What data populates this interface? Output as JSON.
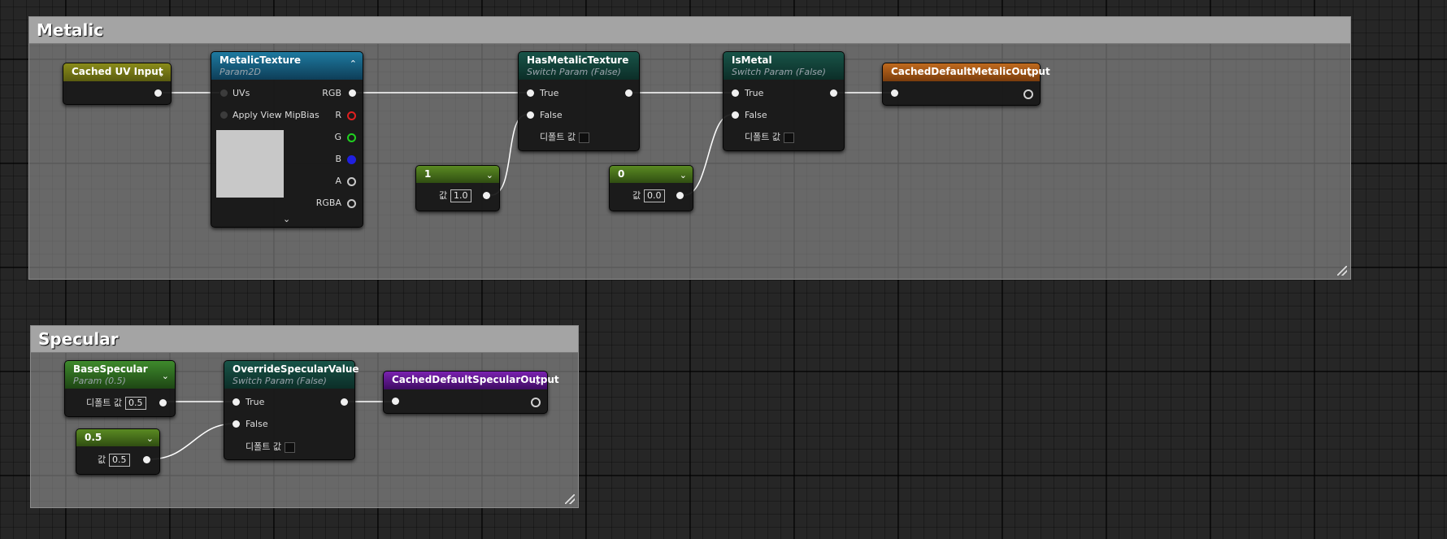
{
  "metalic_group": {
    "title": "Metalic"
  },
  "specular_group": {
    "title": "Specular"
  },
  "nodes": {
    "cached_uv": {
      "title": "Cached UV Input"
    },
    "metalic_texture": {
      "title": "MetalicTexture",
      "subtitle": "Param2D",
      "inputs": [
        "UVs",
        "Apply View MipBias"
      ],
      "outputs": [
        "RGB",
        "R",
        "G",
        "B",
        "A",
        "RGBA"
      ]
    },
    "const_1": {
      "title": "1",
      "value_label": "값",
      "value": "1.0"
    },
    "has_metalic_texture": {
      "title": "HasMetalicTexture",
      "subtitle": "Switch Param (False)",
      "true_label": "True",
      "false_label": "False",
      "default_label": "디폴트 값"
    },
    "const_0": {
      "title": "0",
      "value_label": "값",
      "value": "0.0"
    },
    "is_metal": {
      "title": "IsMetal",
      "subtitle": "Switch Param (False)",
      "true_label": "True",
      "false_label": "False",
      "default_label": "디폴트 값"
    },
    "cached_metalic_output": {
      "title": "CachedDefaultMetalicOutput"
    },
    "base_specular": {
      "title": "BaseSpecular",
      "subtitle": "Param (0.5)",
      "default_label": "디폴트 값",
      "value": "0.5"
    },
    "const_05": {
      "title": "0.5",
      "value_label": "값",
      "value": "0.5"
    },
    "override_specular": {
      "title": "OverrideSpecularValue",
      "subtitle": "Switch Param (False)",
      "true_label": "True",
      "false_label": "False",
      "default_label": "디폴트 값"
    },
    "cached_specular_output": {
      "title": "CachedDefaultSpecularOutput"
    }
  },
  "icons": {
    "expand": "chevron-down-icon",
    "collapse": "chevron-up-icon",
    "resize": "resize-grip-icon"
  },
  "colors": {
    "uv_header": "#8a8c1a",
    "texture_header": "#1a6a8a",
    "switch_header": "#14483e",
    "const_header": "#4e7a1c",
    "metalic_output_header": "#b0601a",
    "specular_output_header": "#6a1a9a",
    "param_header": "#3a7a2a",
    "wire": "#ffffff",
    "pin_r": "#e02020",
    "pin_g": "#20d020",
    "pin_b": "#2020e0"
  }
}
